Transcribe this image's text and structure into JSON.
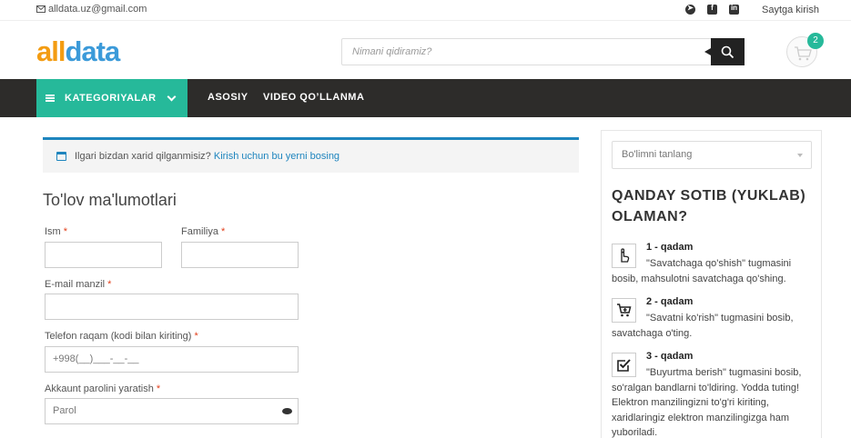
{
  "topbar": {
    "email": "alldata.uz@gmail.com",
    "socials": [
      "telegram-icon",
      "facebook-icon",
      "linkedin-icon"
    ],
    "login": "Saytga kirish"
  },
  "header": {
    "logo_part1": "all",
    "logo_part2": "data",
    "search_placeholder": "Nimani qidiramiz?",
    "cart_count": "2"
  },
  "nav": {
    "categories": "KATEGORIYALAR",
    "links": [
      "ASOSIY",
      "VIDEO QO’LLANMA"
    ]
  },
  "checkout": {
    "notice_text": "Ilgari bizdan xarid qilganmisiz?",
    "notice_link": "Kirish uchun bu yerni bosing",
    "title": "To'lov ma'lumotlari",
    "fields": {
      "first_name": "Ism",
      "last_name": "Familiya",
      "email": "E-mail manzil",
      "phone": "Telefon raqam (kodi bilan kiriting)",
      "phone_value": "+998(__)___-__-__",
      "password": "Akkaunt parolini yaratish",
      "password_placeholder": "Parol",
      "required_mark": "*"
    }
  },
  "sidebar": {
    "select_placeholder": "Bo'limni tanlang",
    "how_title": "QANDAY SOTIB (YUKLAB) OLAMAN?",
    "steps": [
      {
        "title": "1 - qadam",
        "desc": "\"Savatchaga qo'shish\" tugmasini bosib, mahsulotni savatchaga qo'shing.",
        "icon": "hand-pointer-icon"
      },
      {
        "title": "2 - qadam",
        "desc": "\"Savatni ko'rish\" tugmasini bosib, savatchaga o'ting.",
        "icon": "cart-add-icon"
      },
      {
        "title": "3 - qadam",
        "desc": "\"Buyurtma berish\" tugmasini bosib, so'ralgan bandlarni to'ldiring. Yodda tuting! Elektron manzilingizni to'g'ri kiriting, xaridlaringiz elektron manzilingizga ham yuboriladi.",
        "icon": "checkbox-icon"
      }
    ]
  },
  "colors": {
    "accent": "#26b99a",
    "nav_bg": "#2d2c2a",
    "link": "#1e85be",
    "logo_orange": "#f39c12",
    "logo_blue": "#3b9ad9",
    "required": "#e2401c"
  }
}
